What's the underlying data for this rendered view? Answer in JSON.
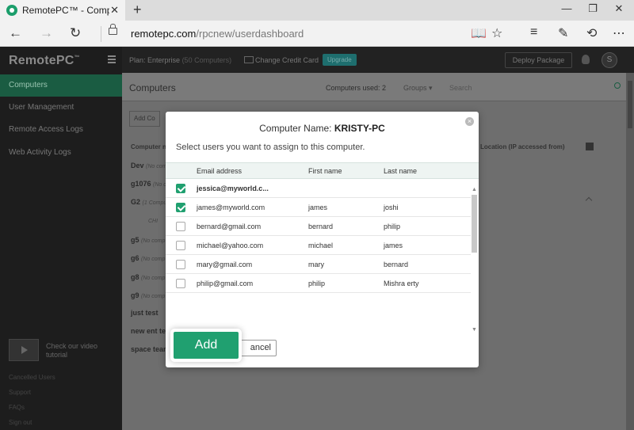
{
  "browser": {
    "tab_title": "RemotePC™ - Computer",
    "tab_close": "✕",
    "new_tab": "+",
    "win_min": "—",
    "win_max": "❐",
    "win_close": "✕",
    "url_host": "remotepc.com",
    "url_path": "/rpcnew/userdashboard",
    "icons": [
      "back-icon",
      "forward-icon",
      "refresh-icon",
      "lock-icon",
      "reading-view-icon",
      "favorite-star-icon",
      "hub-icon",
      "web-note-icon",
      "share-icon",
      "more-icon"
    ]
  },
  "app": {
    "logo": "RemotePC",
    "logo_tm": "™",
    "sidebar": {
      "items": [
        {
          "label": "Computers",
          "active": true
        },
        {
          "label": "User Management",
          "active": false
        },
        {
          "label": "Remote Access Logs",
          "active": false
        },
        {
          "label": "Web Activity Logs",
          "active": false
        }
      ],
      "tutorial": "Check our video tutorial",
      "footer": [
        "Cancelled Users",
        "Support",
        "FAQs",
        "Sign out"
      ]
    },
    "topbar": {
      "plan": "Plan: Enterprise",
      "plan_sub": "(50 Computers)",
      "change_card": "Change Credit Card",
      "upgrade": "Upgrade",
      "deploy": "Deploy Package",
      "avatar": "S"
    },
    "main": {
      "title": "Computers",
      "computers_used": "Computers used: 2",
      "groups": "Groups ▾",
      "search_placeholder": "Search",
      "add_computer": "Add Co",
      "col_name": "Computer na",
      "col_location": "Location (IP accessed from)",
      "rows": [
        {
          "name": "Dev",
          "sub": "(No com"
        },
        {
          "name": "g1076",
          "sub": "(No co"
        },
        {
          "name": "G2",
          "sub": "(1 Compu"
        },
        {
          "name": "",
          "sub": "CHI"
        },
        {
          "name": "g5",
          "sub": "(No comp"
        },
        {
          "name": "g6",
          "sub": "(No comp"
        },
        {
          "name": "g8",
          "sub": "(No comp"
        },
        {
          "name": "g9",
          "sub": "(No comp"
        },
        {
          "name": "just test",
          "sub": ""
        },
        {
          "name": "new ent tea",
          "sub": ""
        },
        {
          "name": "space team",
          "sub": ""
        }
      ]
    }
  },
  "modal": {
    "title_prefix": "Computer Name: ",
    "computer_name": "KRISTY-PC",
    "subtitle": "Select users you want to assign to this computer.",
    "close": "×",
    "headers": {
      "email": "Email address",
      "first": "First name",
      "last": "Last name"
    },
    "users": [
      {
        "email": "jessica@myworld.c...",
        "first": "",
        "last": "",
        "checked": true,
        "bold": true
      },
      {
        "email": "james@myworld.com",
        "first": "james",
        "last": "joshi",
        "checked": true,
        "bold": false
      },
      {
        "email": "bernard@gmail.com",
        "first": "bernard",
        "last": "philip",
        "checked": false,
        "bold": false
      },
      {
        "email": "michael@yahoo.com",
        "first": "michael",
        "last": "james",
        "checked": false,
        "bold": false
      },
      {
        "email": "mary@gmail.com",
        "first": "mary",
        "last": "bernard",
        "checked": false,
        "bold": false
      },
      {
        "email": "philip@gmail.com",
        "first": "philip",
        "last": "Mishra erty",
        "checked": false,
        "bold": false
      }
    ],
    "add_label": "Add",
    "cancel_label": "ancel"
  }
}
